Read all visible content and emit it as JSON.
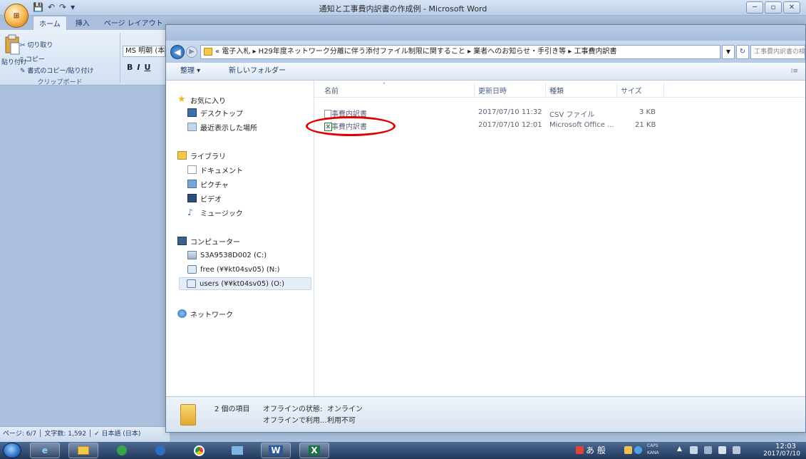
{
  "word": {
    "title": "通知と工事費内訳書の作成例 - Microsoft Word",
    "office_button": "Office",
    "quick_access": [
      "💾",
      "↶",
      "↷",
      "▾"
    ],
    "window_controls": [
      "─",
      "▫",
      "✕"
    ],
    "tabs": [
      "ホーム",
      "挿入",
      "ページ レイアウト"
    ],
    "clipboard": {
      "paste": "貼り付け",
      "cut": "切り取り",
      "copy": "コピー",
      "format_painter": "書式のコピー/貼り付け",
      "group_label": "クリップボード"
    },
    "font_name": "MS 明朝 (本",
    "format_buttons": [
      "B",
      "I",
      "U"
    ],
    "status_bar": "ページ: 6/7 │ 文字数: 1,592 │ ✓ 日本語 (日本)"
  },
  "explorer": {
    "breadcrumb": "« 電子入札 ▸ H29年度ネットワーク分離に伴う添付ファイル制限に関すること ▸ 業者へのお知らせ・手引き等 ▸ 工事費内訳書",
    "search_placeholder": "工事費内訳書の検索",
    "toolbar": {
      "organize": "整理 ▾",
      "new_folder": "新しいフォルダー",
      "view": "⁞≡"
    },
    "nav": {
      "favorites": "お気に入り",
      "desktop": "デスクトップ",
      "recent": "最近表示した場所",
      "libraries": "ライブラリ",
      "documents": "ドキュメント",
      "pictures": "ピクチャ",
      "videos": "ビデオ",
      "music": "ミュージック",
      "computer": "コンピューター",
      "drive_c": "S3A9538D002 (C:)",
      "drive_n": "free (¥¥kt04sv05) (N:)",
      "drive_o": "users (¥¥kt04sv05) (O:)",
      "network": "ネットワーク"
    },
    "columns": {
      "name": "名前",
      "modified": "更新日時",
      "type": "種類",
      "size": "サイズ"
    },
    "files": [
      {
        "name": "工事費内訳書",
        "modified": "2017/07/10 11:32",
        "type": "CSV ファイル",
        "size": "3 KB"
      },
      {
        "name": "工事費内訳書",
        "modified": "2017/07/10 12:01",
        "type": "Microsoft Office ...",
        "size": "21 KB"
      }
    ],
    "details": {
      "count": "2 個の項目",
      "offline_status_label": "オフラインの状態:",
      "offline_status": "オンライン",
      "offline_avail_label": "オフラインで利用...",
      "offline_avail": "利用不可"
    }
  },
  "taskbar": {
    "tray_text": "あ 般",
    "caps": "CAPS",
    "kana": "KANA",
    "time": "12:03",
    "date": "2017/07/10",
    "word_icon": "W",
    "excel_icon": "X"
  }
}
